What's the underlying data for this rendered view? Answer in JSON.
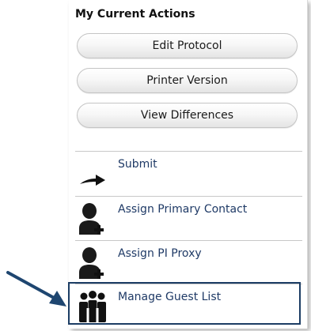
{
  "panel": {
    "title": "My Current Actions",
    "buttons": [
      {
        "label": "Edit Protocol"
      },
      {
        "label": "Printer Version"
      },
      {
        "label": "View Differences"
      }
    ],
    "actions": [
      {
        "label": "Submit",
        "icon": "arrow-right-icon"
      },
      {
        "label": "Assign Primary Contact",
        "icon": "add-user-icon"
      },
      {
        "label": "Assign PI Proxy",
        "icon": "add-user-icon"
      },
      {
        "label": "Manage Guest List",
        "icon": "group-icon"
      }
    ]
  },
  "colors": {
    "link": "#1f3a66",
    "highlight_border": "#1c3d64",
    "callout_arrow": "#1e4670"
  }
}
